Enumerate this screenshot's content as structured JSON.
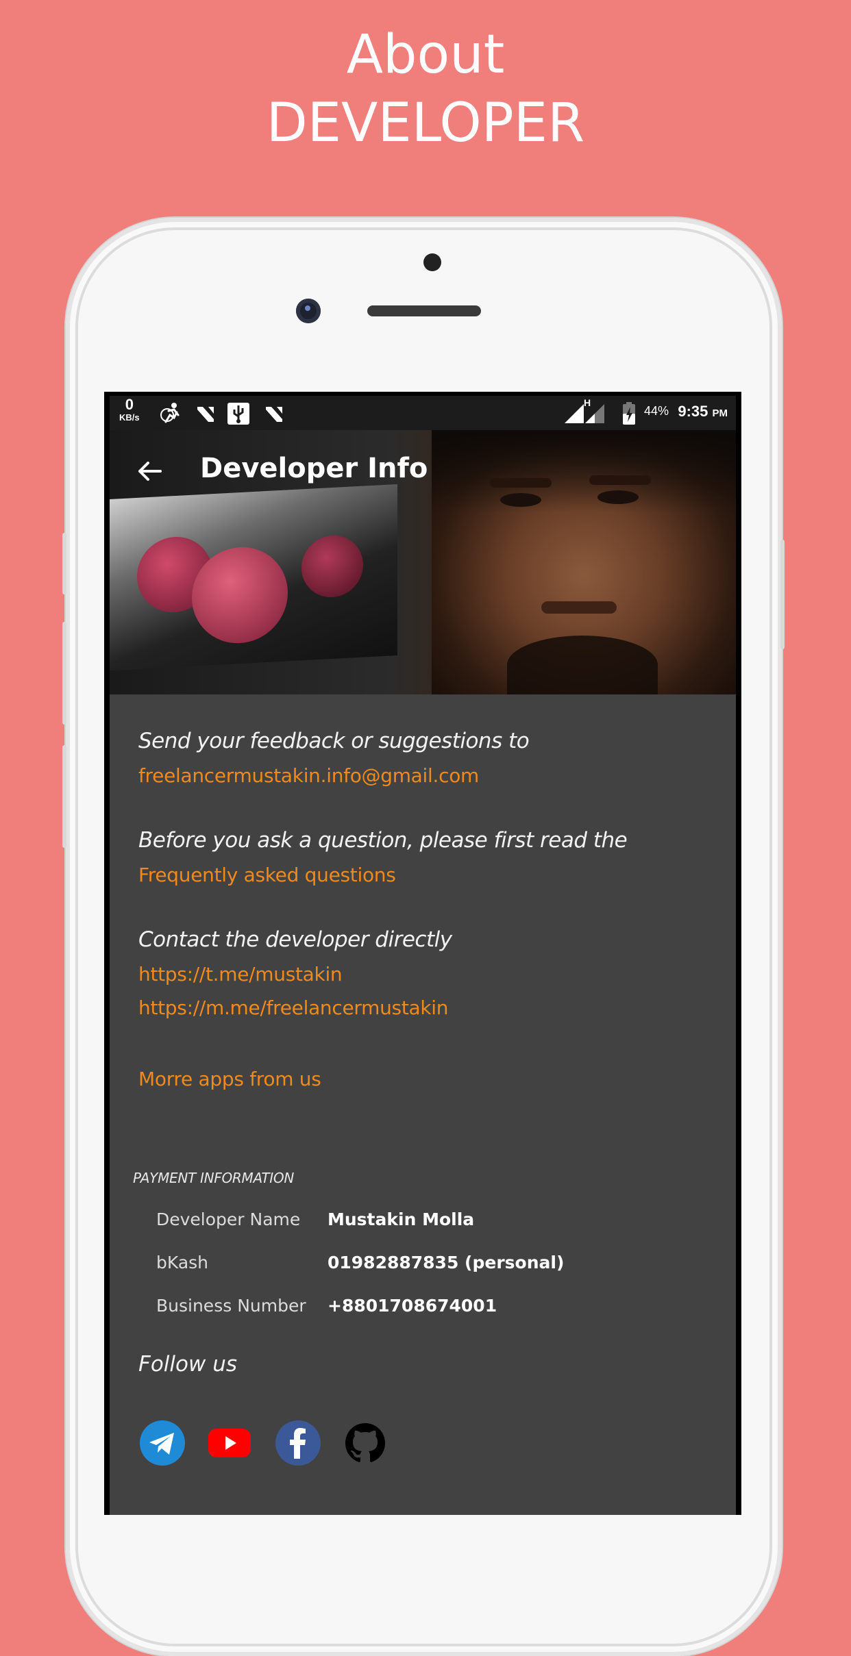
{
  "promo": {
    "title_line1": "About",
    "title_line2": "DEVELOPER"
  },
  "status_bar": {
    "net_speed_value": "0",
    "net_speed_unit": "KB/s",
    "network_type": "H",
    "battery": "44%",
    "time": "9:35",
    "time_suffix": "PM",
    "icons": [
      "run-icon",
      "n-icon",
      "usb-icon",
      "n-icon",
      "signal-icon",
      "signal-h-icon",
      "battery-icon"
    ]
  },
  "header": {
    "title": "Developer Info",
    "back_icon": "arrow-left-icon"
  },
  "feedback": {
    "text": "Send your feedback or suggestions to",
    "email": "freelancermustakin.info@gmail.com"
  },
  "faq": {
    "text": "Before you ask a question, please first read the",
    "link": "Frequently asked questions"
  },
  "contact": {
    "text": "Contact the developer directly",
    "links": [
      "https://t.me/mustakin",
      "https://m.me/freelancermustakin"
    ]
  },
  "more_apps": "Morre apps from us",
  "payment": {
    "label": "PAYMENT INFORMATION",
    "rows": [
      {
        "key": "Developer Name",
        "value": "Mustakin Molla"
      },
      {
        "key": "bKash",
        "value": "01982887835 (personal)"
      },
      {
        "key": "Business Number",
        "value": "+8801708674001"
      }
    ]
  },
  "follow": {
    "text": "Follow us",
    "icons": [
      "telegram-icon",
      "youtube-icon",
      "facebook-icon",
      "github-icon"
    ]
  },
  "colors": {
    "background": "#f07f7c",
    "content_bg": "#424242",
    "link": "#f08a1c"
  }
}
